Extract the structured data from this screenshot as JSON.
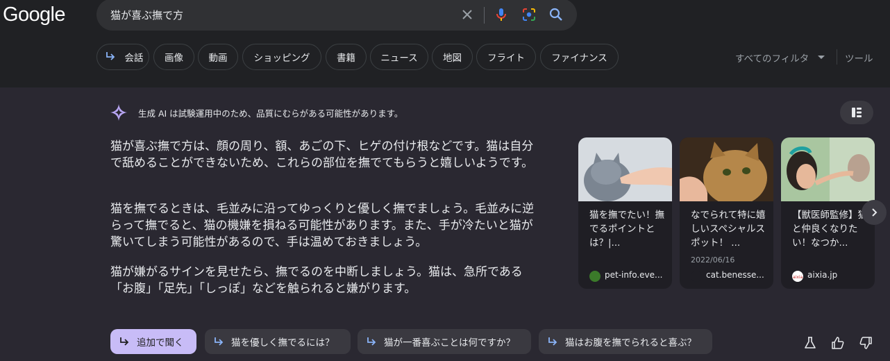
{
  "header": {
    "logo": "Google",
    "search": {
      "value": "猫が喜ぶ撫で方"
    },
    "chips": [
      "会話",
      "画像",
      "動画",
      "ショッピング",
      "書籍",
      "ニュース",
      "地図",
      "フライト",
      "ファイナンス"
    ],
    "all_filters": "すべてのフィルタ",
    "tools": "ツール"
  },
  "ai": {
    "notice": "生成 AI は試験運用中のため、品質にむらがある可能性があります。",
    "paragraphs": [
      "猫が喜ぶ撫で方は、顔の周り、額、あごの下、ヒゲの付け根などです。猫は自分で舐めることができないため、これらの部位を撫でてもらうと嬉しいようです。",
      "猫を撫でるときは、毛並みに沿ってゆっくりと優しく撫でましょう。毛並みに逆らって撫でると、猫の機嫌を損ねる可能性があります。また、手が冷たいと猫が驚いてしまう可能性があるので、手は温めておきましょう。",
      "猫が嫌がるサインを見せたら、撫でるのを中断しましょう。猫は、急所である「お腹」「足先」「しっぽ」などを触られると嫌がります。"
    ],
    "cards": [
      {
        "title": "猫を撫でたい！撫でるポイントとは？|...",
        "date": "",
        "source": "pet-info.eve...",
        "favicon_color": "#3b7a2a"
      },
      {
        "title": "なでられて特に嬉しいスペシャルスポット！ ...",
        "date": "2022/06/16",
        "source": "cat.benesse...",
        "favicon_color": "#1f1e24"
      },
      {
        "title": "【獣医師監修】猫と仲良くなりたい！なつか...",
        "date": "",
        "source": "aixia.jp",
        "favicon_color": "#c62828"
      }
    ],
    "followups": [
      "追加で聞く",
      "猫を優しく撫でるには？",
      "猫が一番喜ぶことは何ですか？",
      "猫はお腹を撫でられると喜ぶ？"
    ]
  }
}
